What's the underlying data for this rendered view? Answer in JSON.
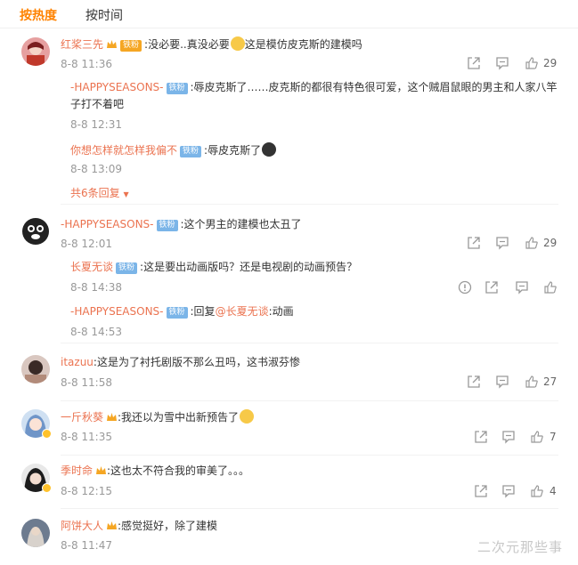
{
  "tabs": {
    "hot": "按热度",
    "time": "按时间"
  },
  "colors": {
    "accent": "#ff8200",
    "username": "#eb7350",
    "fan_badge": "#7bb5e8",
    "meta": "#999999"
  },
  "comments": [
    {
      "user": "红桨三先",
      "fan_badge": "铁粉",
      "text": ":没必要..真没必要",
      "text2": "这是模仿皮克斯的建模吗",
      "time": "8-8 11:36",
      "likes": "29",
      "replies": [
        {
          "user": "-HAPPYSEASONS-",
          "fan_badge": "铁粉",
          "text": ":辱皮克斯了……皮克斯的都很有特色很可爱，这个贼眉鼠眼的男主和人家八竿",
          "text_cont": "子打不着吧",
          "time": "8-8 12:31"
        },
        {
          "user": "你想怎样就怎样我偏不",
          "fan_badge": "铁粉",
          "text": ":辱皮克斯了",
          "time": "8-8 13:09"
        }
      ],
      "more_replies": "共6条回复"
    },
    {
      "user": "-HAPPYSEASONS-",
      "fan_badge": "铁粉",
      "text": ":这个男主的建模也太丑了",
      "time": "8-8 12:01",
      "likes": "29",
      "replies": [
        {
          "user": "长夏无谈",
          "fan_badge": "铁粉",
          "text": ":这是要出动画版吗？还是电视剧的动画预告？",
          "time": "8-8 14:38"
        },
        {
          "user": "-HAPPYSEASONS-",
          "fan_badge": "铁粉",
          "reply_prefix": ":回复",
          "reply_to": "@长夏无谈",
          "text": ":动画",
          "time": "8-8 14:53"
        }
      ]
    },
    {
      "user": "itazuu",
      "text": ":这是为了衬托剧版不那么丑吗，这书淑芬惨",
      "time": "8-8 11:58",
      "likes": "27"
    },
    {
      "user": "一斤秋葵",
      "text": ":我还以为雪中出新预告了",
      "time": "8-8 11:35",
      "likes": "7"
    },
    {
      "user": "季时命",
      "text": ":这也太不符合我的审美了。。。",
      "time": "8-8 12:15",
      "likes": "4"
    },
    {
      "user": "阿饼大人",
      "text": ":感觉挺好，除了建模",
      "time": "8-8 11:47"
    }
  ],
  "watermark": "二次元那些事"
}
